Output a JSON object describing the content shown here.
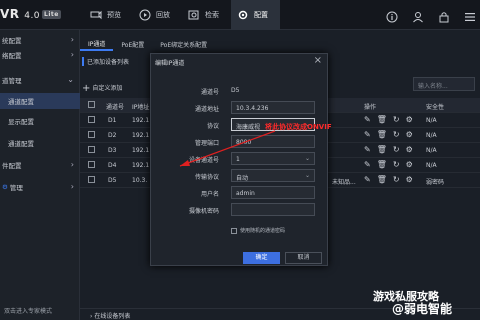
{
  "app": {
    "logo": "VR",
    "version": "4.0",
    "badge": "Lite"
  },
  "topnav": [
    {
      "label": "预览",
      "icon": "camera-icon"
    },
    {
      "label": "回放",
      "icon": "playback-icon"
    },
    {
      "label": "检索",
      "icon": "folder-search-icon"
    },
    {
      "label": "配置",
      "icon": "gear-icon",
      "active": true
    }
  ],
  "sidebar": [
    {
      "label": "统配置",
      "chevron": "›"
    },
    {
      "label": "络配置",
      "chevron": "›"
    },
    {
      "label": "道管理",
      "chevron": "⌄"
    },
    {
      "label": "通道配置",
      "active": true
    },
    {
      "label": "显示配置"
    },
    {
      "label": "通道配置"
    },
    {
      "label": "件配置",
      "chevron": "›"
    },
    {
      "label": "管理",
      "chevron": "›"
    }
  ],
  "sidebar_footer": "双击进入专家模式",
  "tabs": [
    "IP通道",
    "PoE配置",
    "PoE绑定关系配置"
  ],
  "list_title": "已添加设备列表",
  "add_button": "自定义添加",
  "search_placeholder": "输入名称...",
  "table": {
    "headers": [
      "通道号",
      "IP地址",
      "",
      "",
      "",
      "",
      "操作",
      "",
      "安全性"
    ],
    "rows": [
      {
        "ch": "D1",
        "ip": "192.1",
        "security": "N/A"
      },
      {
        "ch": "D2",
        "ip": "192.1",
        "security": "N/A"
      },
      {
        "ch": "D3",
        "ip": "192.1",
        "security": "N/A"
      },
      {
        "ch": "D4",
        "ip": "192.1",
        "security": "N/A"
      },
      {
        "ch": "D5",
        "ip": "10.3.",
        "extra": "未知品...",
        "security": "弱密码"
      }
    ]
  },
  "online_list": "在线设备列表",
  "dialog": {
    "title": "编辑IP通道",
    "fields": [
      {
        "label": "通道号",
        "value": "D5",
        "type": "text"
      },
      {
        "label": "通道地址",
        "value": "10.3.4.236",
        "type": "input"
      },
      {
        "label": "协议",
        "value": "海康威视",
        "type": "select",
        "highlight": true
      },
      {
        "label": "管理端口",
        "value": "8000",
        "type": "input"
      },
      {
        "label": "设备通道号",
        "value": "1",
        "type": "select"
      },
      {
        "label": "传输协议",
        "value": "自动",
        "type": "select"
      },
      {
        "label": "用户名",
        "value": "admin",
        "type": "input"
      },
      {
        "label": "摄像机密码",
        "value": "",
        "type": "input"
      }
    ],
    "checkbox_label": "使用随机的通道密码",
    "ok": "确定",
    "cancel": "取消"
  },
  "annotation": "将此协议改成ONVIF",
  "watermark": {
    "line1": "游戏私服攻略",
    "line2": "@弱电智能"
  }
}
